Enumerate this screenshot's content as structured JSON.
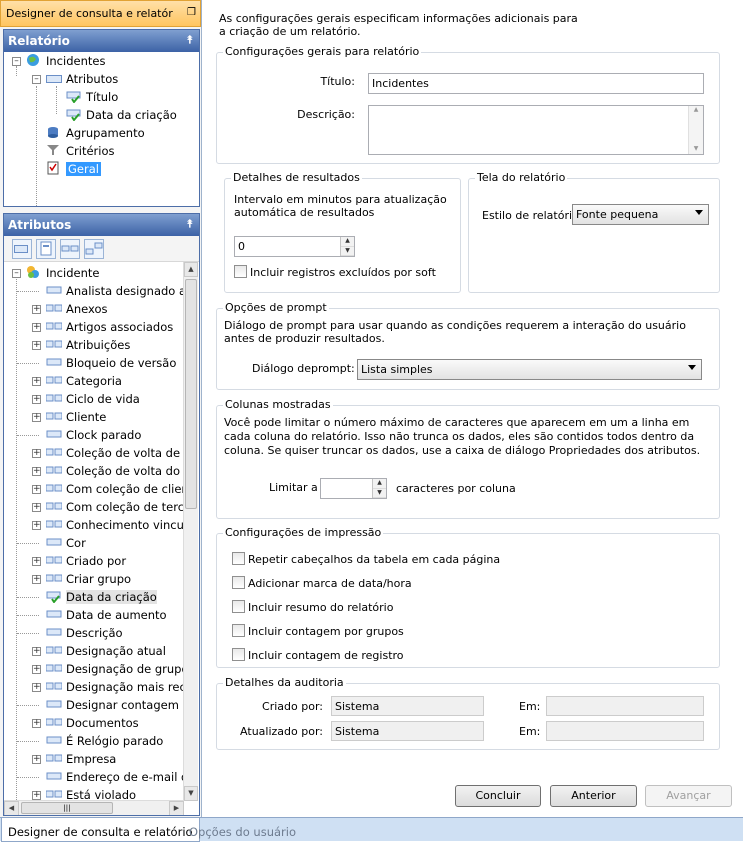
{
  "doc_tab": {
    "title": "Designer de consulta e relatór"
  },
  "relatorio_panel": {
    "title": "Relatório",
    "items": [
      {
        "label": "Incidentes"
      },
      {
        "label": "Atributos"
      },
      {
        "label": "Título"
      },
      {
        "label": "Data da criação"
      },
      {
        "label": "Agrupamento"
      },
      {
        "label": "Critérios"
      },
      {
        "label": "Geral"
      }
    ]
  },
  "atributos_panel": {
    "title": "Atributos",
    "root": "Incidente",
    "items": [
      {
        "label": "Analista designado at"
      },
      {
        "label": "Anexos"
      },
      {
        "label": "Artigos associados"
      },
      {
        "label": "Atribuições"
      },
      {
        "label": "Bloqueio de versão"
      },
      {
        "label": "Categoria"
      },
      {
        "label": "Ciclo de vida"
      },
      {
        "label": "Cliente"
      },
      {
        "label": "Clock parado"
      },
      {
        "label": "Coleção de volta de te"
      },
      {
        "label": "Coleção de volta do c"
      },
      {
        "label": "Com coleção de clien"
      },
      {
        "label": "Com coleção de terce"
      },
      {
        "label": "Conhecimento vincul"
      },
      {
        "label": "Cor"
      },
      {
        "label": "Criado por"
      },
      {
        "label": "Criar grupo"
      },
      {
        "label": "Data da criação"
      },
      {
        "label": "Data de aumento"
      },
      {
        "label": "Descrição"
      },
      {
        "label": "Designação atual"
      },
      {
        "label": "Designação de grupo"
      },
      {
        "label": "Designação mais rece"
      },
      {
        "label": "Designar contagem"
      },
      {
        "label": "Documentos"
      },
      {
        "label": "É Relógio parado"
      },
      {
        "label": "Empresa"
      },
      {
        "label": "Endereço de e-mail d"
      },
      {
        "label": "Está violado"
      }
    ]
  },
  "intro": "As configurações gerais especificam informações adicionais para a criação de um relatório.",
  "general": {
    "title": "Configurações gerais para relatório",
    "title_label": "Título:",
    "title_value": "Incidentes",
    "desc_label": "Descrição:"
  },
  "results": {
    "title": "Detalhes de resultados",
    "interval_text": "Intervalo em minutos para atualização automática de resultados",
    "interval_value": "0",
    "include_deleted": "Incluir registros excluídos por soft"
  },
  "screen": {
    "title": "Tela do relatório",
    "style_label": "Estilo de relatório",
    "style_value": "Fonte pequena"
  },
  "prompt": {
    "title": "Opções de prompt",
    "text": "Diálogo de prompt para usar quando as condições requerem a interação do usuário antes de produzir resultados.",
    "dialog_label": "Diálogo deprompt:",
    "dialog_value": "Lista simples"
  },
  "columns": {
    "title": "Colunas mostradas",
    "text": "Você pode limitar o número máximo de caracteres que aparecem em um a linha em cada coluna do relatório. Isso não trunca os dados, eles são contidos todos dentro da coluna. Se quiser truncar os dados, use a caixa de diálogo Propriedades dos atributos.",
    "limit_label": "Limitar a",
    "limit_suffix": "caracteres por coluna"
  },
  "print": {
    "title": "Configurações de impressão",
    "options": [
      "Repetir cabeçalhos da tabela em cada página",
      "Adicionar marca de data/hora",
      "Incluir resumo do relatório",
      "Incluir contagem por grupos",
      "Incluir contagem de registro"
    ]
  },
  "audit": {
    "title": "Detalhes da auditoria",
    "created_label": "Criado por:",
    "created_value": "Sistema",
    "updated_label": "Atualizado por:",
    "updated_value": "Sistema",
    "em_label": "Em:"
  },
  "buttons": {
    "finish": "Concluir",
    "back": "Anterior",
    "next": "Avançar"
  },
  "bottom_tabs": [
    "Designer de consulta e relatório",
    "Opções do usuário"
  ]
}
